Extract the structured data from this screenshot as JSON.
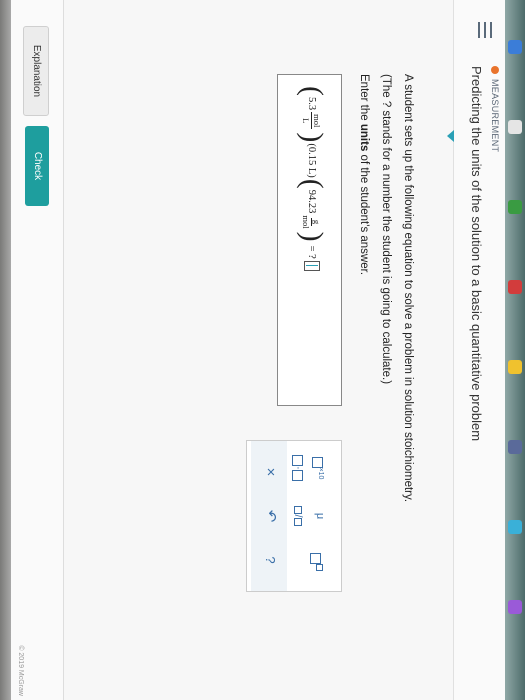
{
  "header": {
    "topic": "MEASUREMENT",
    "title": "Predicting the units of the solution to a basic quantitative problem"
  },
  "question": {
    "line1": "A student sets up the following equation to solve a problem in solution stoichiometry.",
    "line2": "(The ? stands for a number the student is going to calculate.)",
    "line3_prefix": "Enter the ",
    "line3_bold": "units",
    "line3_suffix": " of the student's answer."
  },
  "equation": {
    "term1_value": "5.3",
    "term1_num_unit": "mol",
    "term1_den_unit": "L",
    "term2": "(0.15 L)",
    "term3_value": "94.23",
    "term3_num_unit": "g",
    "term3_den_unit": "mol",
    "result": "= ?"
  },
  "palette": {
    "sci_notation": "×10",
    "mu": "μ",
    "dot": "·",
    "clear": "×",
    "undo": "↶",
    "help": "?"
  },
  "footer": {
    "explanation_label": "Explanation",
    "check_label": "Check",
    "copyright": "© 2019 McGraw"
  }
}
